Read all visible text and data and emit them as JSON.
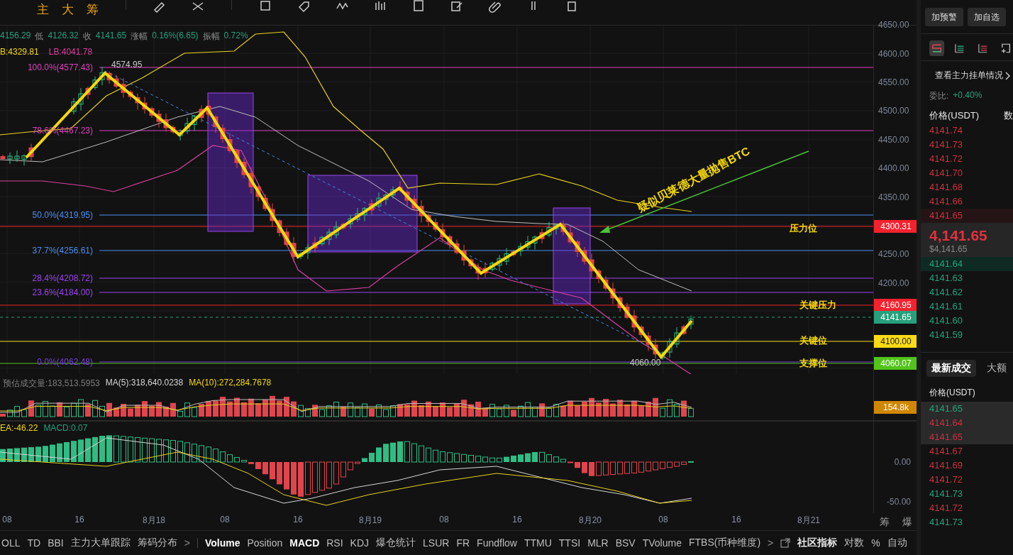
{
  "toolbar": {
    "tools": [
      "主",
      "大",
      "筹"
    ]
  },
  "info": {
    "items": [
      {
        "value": "4156.29"
      },
      {
        "label": "低",
        "value": "4126.32"
      },
      {
        "label": "收",
        "value": "4141.65"
      },
      {
        "label": "涨幅",
        "value": "0.16%(6.65)"
      },
      {
        "label": "振幅",
        "value": "0.72%"
      }
    ]
  },
  "bands": [
    {
      "text": "B:4329.81",
      "color": "#f5d90a"
    },
    {
      "text": "LB:4041.78",
      "color": "#d9409f"
    }
  ],
  "price_axis": {
    "ticks": [
      "4650.00",
      "4600.00",
      "4550.00",
      "4500.00",
      "4450.00",
      "4400.00",
      "4350.00",
      "4250.00",
      "4200.00"
    ]
  },
  "price_tags": [
    {
      "text": "4300.31",
      "color": "#f5222d"
    },
    {
      "text": "4160.95",
      "color": "#f5222d"
    },
    {
      "text": "4141.65",
      "color": "#26a17b"
    },
    {
      "text": "4100.00",
      "color": "#fadb14"
    },
    {
      "text": "4060.07",
      "color": "#52c41a"
    }
  ],
  "fib_levels": [
    {
      "label": "100.0%(4577.43)",
      "color": "#e040c0"
    },
    {
      "label": "78.6%(4467.23)",
      "color": "#e040c0"
    },
    {
      "label": "50.0%(4319.95)",
      "color": "#4a8ff0"
    },
    {
      "label": "37.7%(4256.61)",
      "color": "#4a8ff0"
    },
    {
      "label": "28.4%(4208.72)",
      "color": "#9b45f0"
    },
    {
      "label": "23.6%(4184.00)",
      "color": "#9b45f0"
    },
    {
      "label": "0.0%(4062.48)",
      "color": "#7a3fe0"
    }
  ],
  "markers": [
    "4574.95",
    "4060.00"
  ],
  "zone_labels": [
    "压力位",
    "关键压力",
    "关键位",
    "支撑位"
  ],
  "annotation": "疑似贝莱德大量抛售BTC",
  "volume": {
    "legend": [
      {
        "text": "预估成交量:183,513.5953",
        "color": "#7b7b7b"
      },
      {
        "text": "MA(5):318,640.0238",
        "color": "#d6d6d6"
      },
      {
        "text": "MA(10):272,284.7678",
        "color": "#f5d90a"
      }
    ],
    "tag": "154.8k"
  },
  "macd": {
    "legend": [
      {
        "text": "EA:-46.22",
        "color": "#f5d90a"
      },
      {
        "text": "MACD:0.07",
        "color": "#26a17b"
      }
    ],
    "ticks": [
      "0.00",
      "-50.00"
    ]
  },
  "time_axis": [
    "08",
    "16",
    "8月18",
    "08",
    "16",
    "8月19",
    "08",
    "16",
    "8月20",
    "08",
    "16",
    "8月21"
  ],
  "axis_marks": [
    "筹",
    "爆"
  ],
  "indicator_bar": [
    {
      "kind": "tab",
      "label": "OLL",
      "selected": false
    },
    {
      "kind": "tab",
      "label": "TD",
      "selected": false
    },
    {
      "kind": "tab",
      "label": "BBI",
      "selected": false
    },
    {
      "kind": "tab",
      "label": "主力大单跟踪",
      "selected": false
    },
    {
      "kind": "tab",
      "label": "筹码分布",
      "selected": false
    },
    {
      "kind": "chevron",
      "label": ">"
    },
    {
      "kind": "tab",
      "label": "Volume",
      "selected": true
    },
    {
      "kind": "tab",
      "label": "Position",
      "selected": false
    },
    {
      "kind": "tab",
      "label": "MACD",
      "selected": true
    },
    {
      "kind": "tab",
      "label": "RSI",
      "selected": false
    },
    {
      "kind": "tab",
      "label": "KDJ",
      "selected": false
    },
    {
      "kind": "tab",
      "label": "爆仓统计",
      "selected": false
    },
    {
      "kind": "tab",
      "label": "LSUR",
      "selected": false
    },
    {
      "kind": "tab",
      "label": "FR",
      "selected": false
    },
    {
      "kind": "tab",
      "label": "Fundflow",
      "selected": false
    },
    {
      "kind": "tab",
      "label": "TTMU",
      "selected": false
    },
    {
      "kind": "tab",
      "label": "TTSI",
      "selected": false
    },
    {
      "kind": "tab",
      "label": "MLR",
      "selected": false
    },
    {
      "kind": "tab",
      "label": "BSV",
      "selected": false
    },
    {
      "kind": "tab",
      "label": "TVolume",
      "selected": false
    },
    {
      "kind": "tab",
      "label": "FTBS(币种维度)",
      "selected": false
    },
    {
      "kind": "chevron",
      "label": ">"
    },
    {
      "kind": "community",
      "label": "社区指标"
    },
    {
      "kind": "option",
      "label": "对数"
    },
    {
      "kind": "option",
      "label": "%"
    },
    {
      "kind": "option",
      "label": "自动"
    }
  ],
  "panel": {
    "buttons": [
      "加预警",
      "加自选"
    ],
    "views": [
      {
        "selected": true
      },
      {
        "selected": false
      },
      {
        "selected": false
      },
      {
        "selected": false
      }
    ],
    "depth_link": "查看主力挂单情况",
    "ratio": {
      "label": "委比:",
      "value": "+0.40%"
    },
    "book_columns": [
      "价格(USDT)",
      "数"
    ],
    "asks": [
      {
        "price": "4141.74",
        "highlighted": false
      },
      {
        "price": "4141.73",
        "highlighted": false
      },
      {
        "price": "4141.72",
        "highlighted": false
      },
      {
        "price": "4141.70",
        "highlighted": false
      },
      {
        "price": "4141.68",
        "highlighted": false
      },
      {
        "price": "4141.66",
        "highlighted": false
      },
      {
        "price": "4141.65",
        "highlighted": true
      }
    ],
    "last_price": "4,141.65",
    "last_price_usd": "$4,141.65",
    "bids": [
      {
        "price": "4141.64",
        "highlighted": true
      },
      {
        "price": "4141.63",
        "highlighted": false
      },
      {
        "price": "4141.62",
        "highlighted": false
      },
      {
        "price": "4141.61",
        "highlighted": false
      },
      {
        "price": "4141.60",
        "highlighted": false
      },
      {
        "price": "4141.59",
        "highlighted": false
      }
    ],
    "trade_tabs": [
      {
        "label": "最新成交",
        "selected": true
      },
      {
        "label": "大额",
        "selected": false
      }
    ],
    "trade_column": "价格(USDT)",
    "trades": [
      {
        "price": "4141.65",
        "color": "#26a17b",
        "highlighted": true
      },
      {
        "price": "4141.64",
        "color": "#c9323d",
        "highlighted": true
      },
      {
        "price": "4141.65",
        "color": "#c9323d",
        "highlighted": true
      },
      {
        "price": "4141.67",
        "color": "#c9323d",
        "highlighted": false
      },
      {
        "price": "4141.69",
        "color": "#c9323d",
        "highlighted": false
      },
      {
        "price": "4141.72",
        "color": "#c9323d",
        "highlighted": false
      },
      {
        "price": "4141.73",
        "color": "#26a17b",
        "highlighted": false
      },
      {
        "price": "4141.72",
        "color": "#c9323d",
        "highlighted": false
      },
      {
        "price": "4141.73",
        "color": "#26a17b",
        "highlighted": false
      }
    ]
  }
}
